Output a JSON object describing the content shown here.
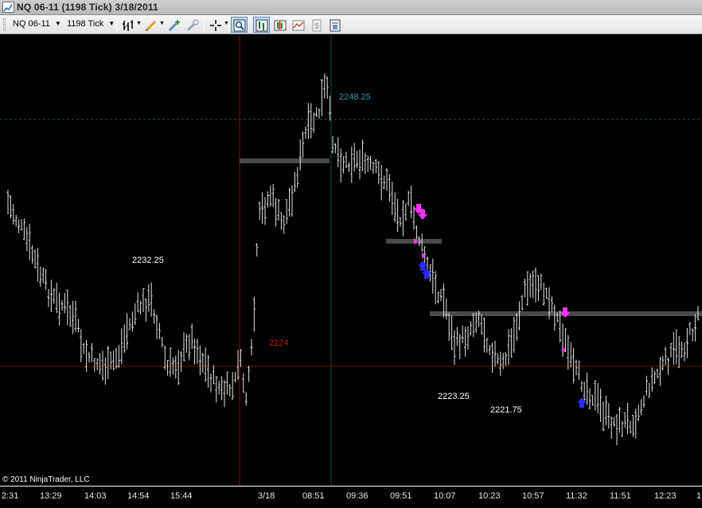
{
  "window": {
    "title": "NQ 06-11 (1198 Tick)  3/18/2011"
  },
  "toolbar": {
    "instrument": "NQ 06-11",
    "interval": "1198 Tick",
    "buttons": [
      {
        "name": "bar-type-icon",
        "active": false
      },
      {
        "name": "pencil-draw-icon",
        "active": false
      },
      {
        "name": "strategy-add-icon",
        "active": false
      },
      {
        "name": "strategy-remove-icon",
        "active": false
      },
      {
        "name": "crosshair-icon",
        "active": false
      },
      {
        "name": "zoom-icon",
        "active": true
      },
      {
        "name": "properties-icon",
        "active": true
      },
      {
        "name": "data-box-icon",
        "active": false
      },
      {
        "name": "indicators-icon",
        "active": false
      },
      {
        "name": "money-icon",
        "active": false
      },
      {
        "name": "panel-icon",
        "active": false
      }
    ]
  },
  "chart_data": {
    "type": "ohlc",
    "price_labels": [
      {
        "value": 2248.25,
        "text": "2248.25",
        "color": "#2c9ca3"
      },
      {
        "value": 2232.25,
        "text": "2232.25",
        "color": "#ffffff"
      },
      {
        "value": 2224,
        "text": "2224",
        "color": "#b01717"
      },
      {
        "value": 2223.25,
        "text": "2223.25",
        "color": "#ffffff"
      },
      {
        "value": 2221.75,
        "text": "2221.75",
        "color": "#ffffff"
      }
    ],
    "time_labels": [
      "2:31",
      "13:29",
      "14:03",
      "14:54",
      "15:44",
      "3/18",
      "08:51",
      "09:36",
      "09:51",
      "10:07",
      "10:23",
      "10:57",
      "11:32",
      "11:51",
      "12:23",
      "1"
    ],
    "colors": {
      "bars": "#e6e6e6",
      "zone": "#4a4a4a",
      "sell_marker": "#ff33ff",
      "buy_marker": "#2b2bff",
      "session_line": "#8c0a0a",
      "high_line": "#0f4f2c",
      "level_dash": "#1e5a45",
      "level_red": "#7a0b0b"
    }
  },
  "footer": {
    "copyright": "© 2011 NinjaTrader, LLC"
  }
}
